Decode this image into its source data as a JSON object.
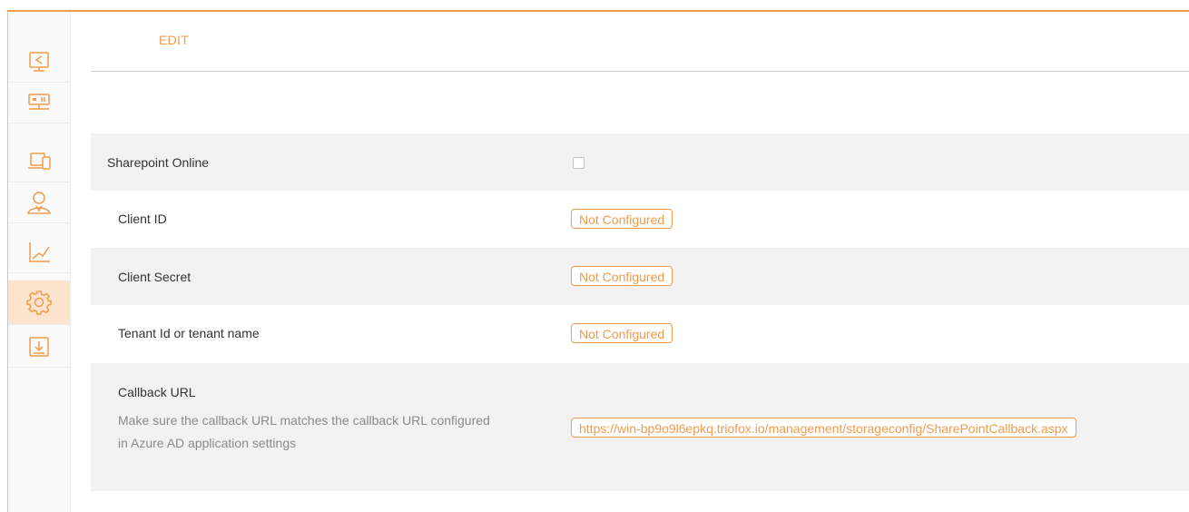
{
  "tabs": {
    "edit": "EDIT"
  },
  "sidebar": {
    "items": [
      {
        "icon": "share-monitor-icon"
      },
      {
        "icon": "server-network-icon"
      },
      {
        "icon": "devices-icon"
      },
      {
        "icon": "users-icon"
      },
      {
        "icon": "chart-icon"
      },
      {
        "icon": "gear-icon",
        "active": true
      },
      {
        "icon": "download-icon"
      }
    ]
  },
  "settings": {
    "sharepoint_online": {
      "label": "Sharepoint Online",
      "checked": false
    },
    "client_id": {
      "label": "Client ID",
      "value": "Not Configured"
    },
    "client_secret": {
      "label": "Client Secret",
      "value": "Not Configured"
    },
    "tenant_id": {
      "label": "Tenant Id or tenant name",
      "value": "Not Configured"
    },
    "callback_url": {
      "label": "Callback URL",
      "description": "Make sure the callback URL matches the callback URL configured in Azure AD application settings",
      "value": "https://win-bp9o9l6epkq.triofox.io/management/storageconfig/SharePointCallback.aspx"
    }
  },
  "colors": {
    "accent": "#f29b4b",
    "row_gray": "#f2f2f2",
    "active_bg": "#fde4cf"
  }
}
